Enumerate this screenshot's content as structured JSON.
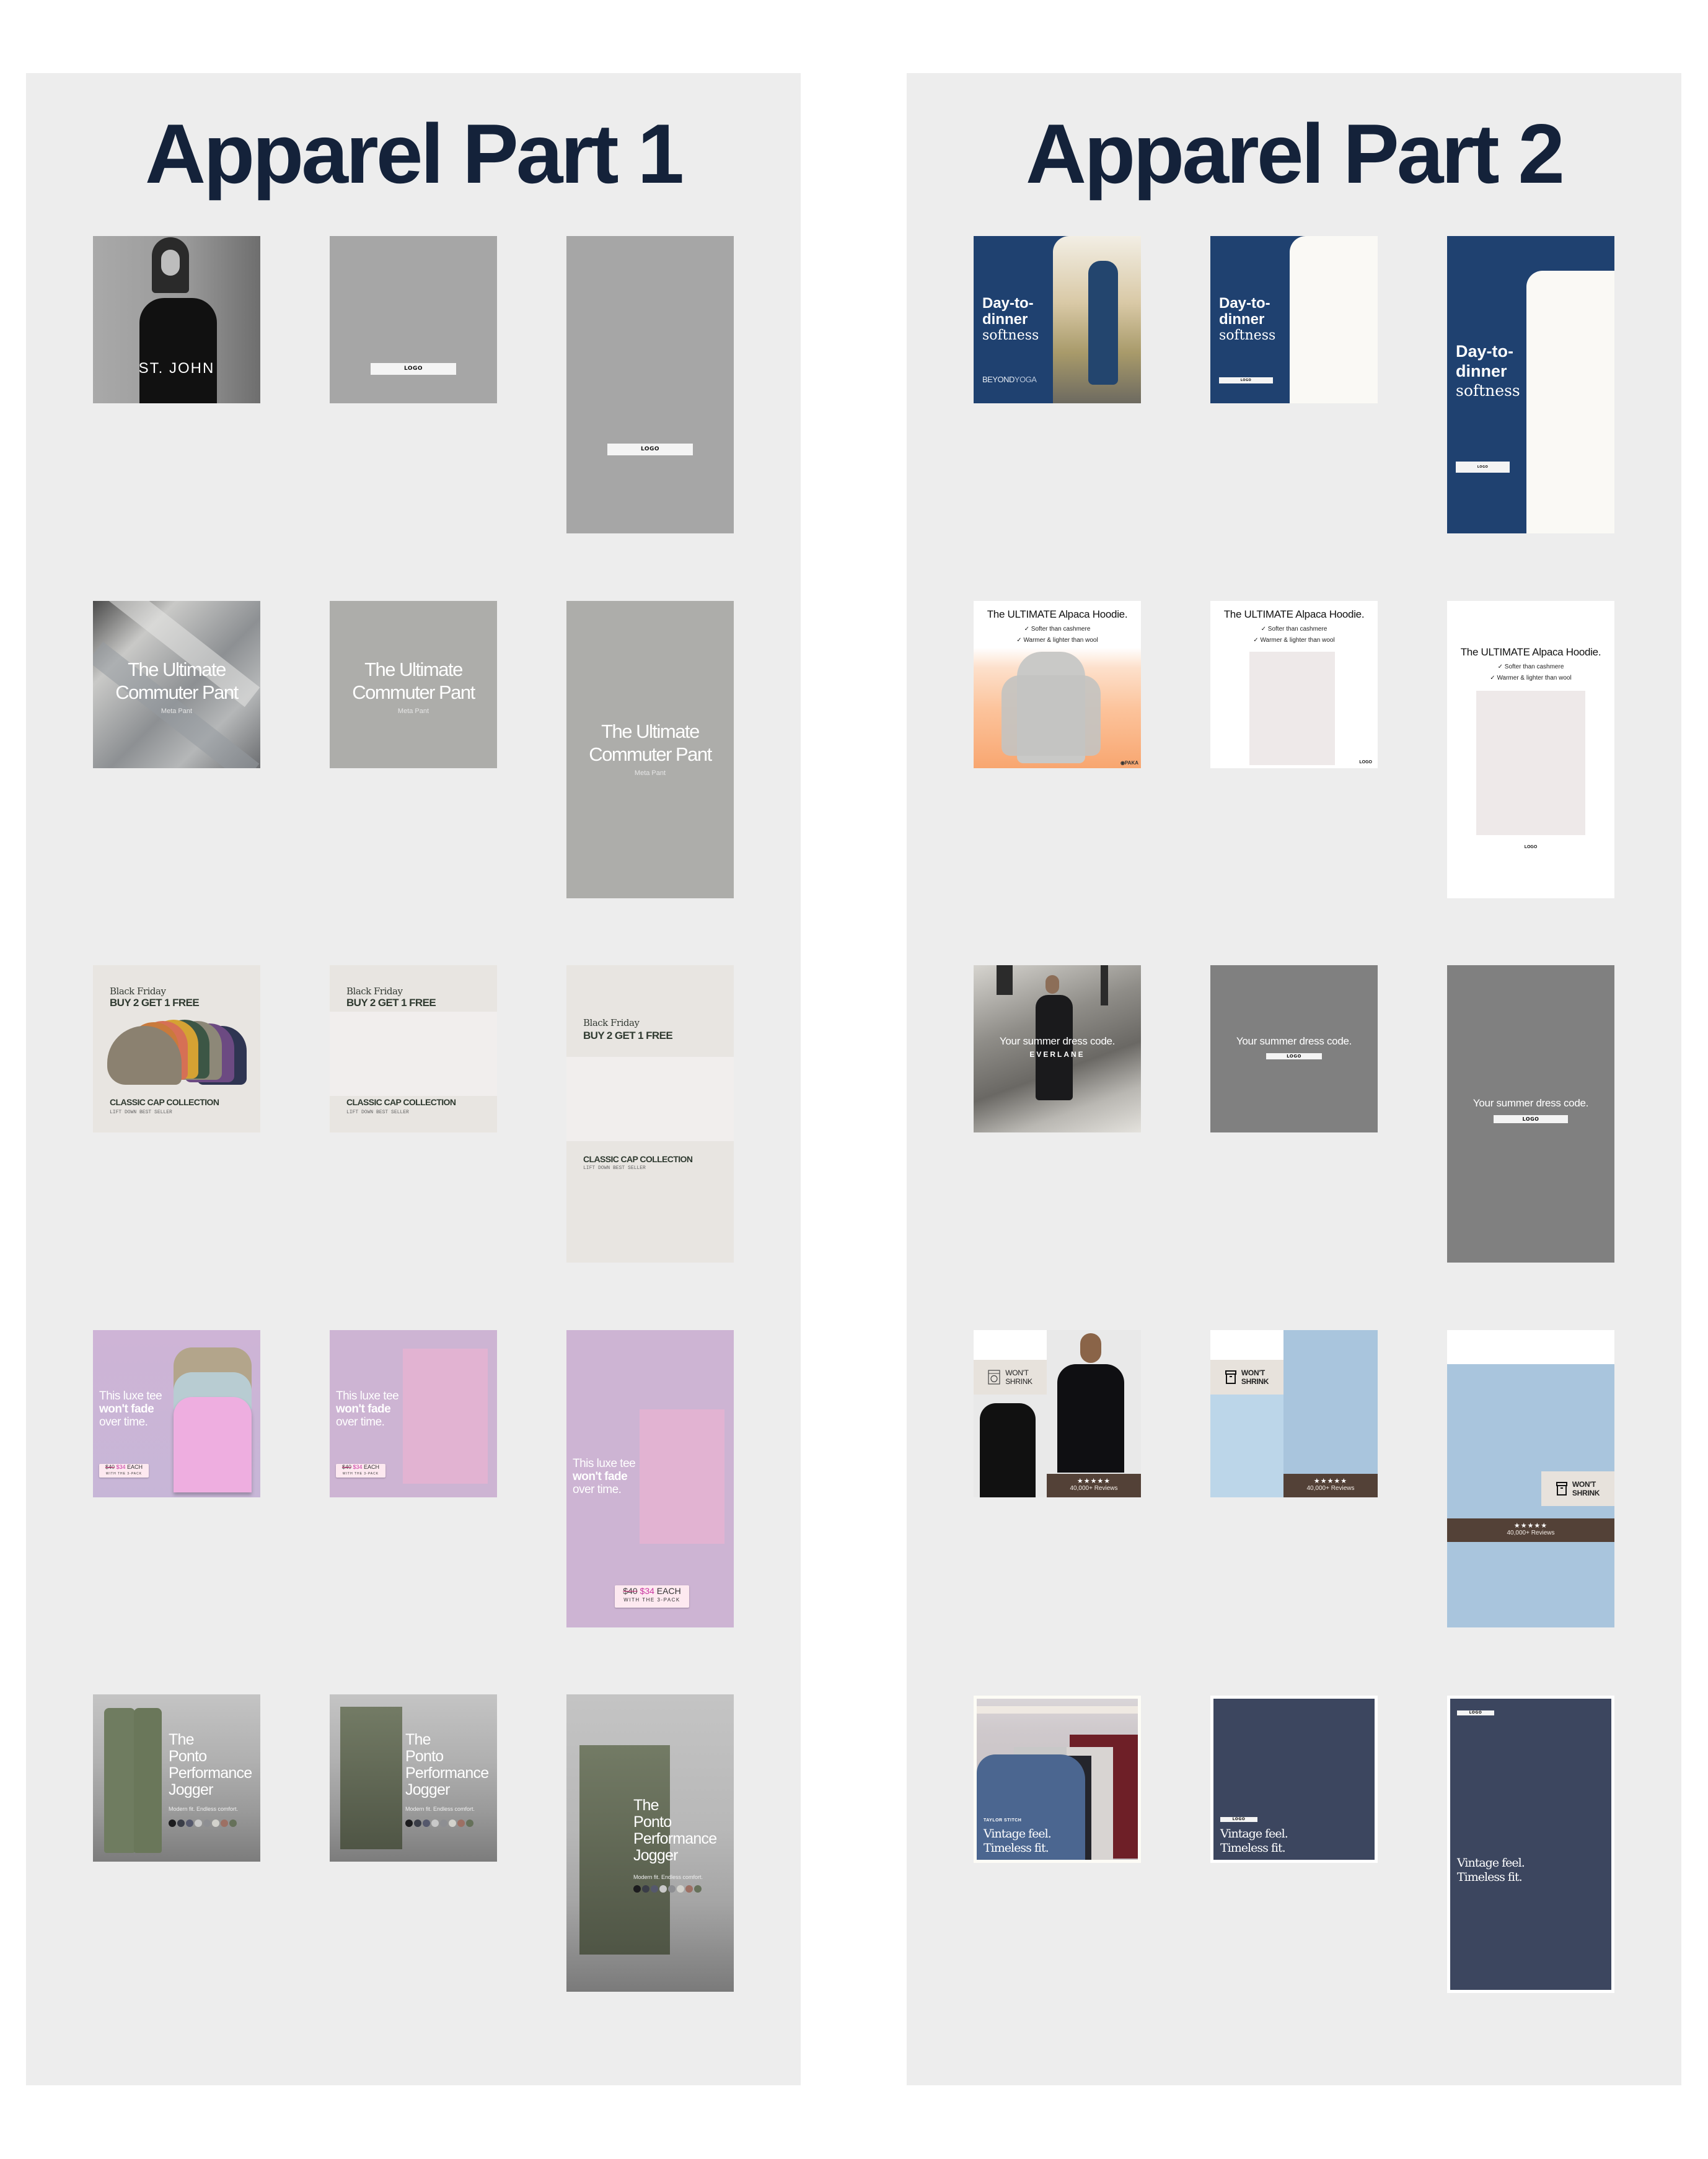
{
  "panels": [
    {
      "title": "Apparel Part 1"
    },
    {
      "title": "Apparel Part 2"
    }
  ],
  "common": {
    "logo_label": "LOGO"
  },
  "part1": {
    "stjohn": {
      "brand": "ST. JOHN"
    },
    "commuter": {
      "headline_line1": "The Ultimate",
      "headline_line2": "Commuter Pant",
      "sub": "Meta Pant",
      "bg": "#adadaa"
    },
    "caps": {
      "kicker": "Black Friday",
      "offer": "BUY 2 GET 1 FREE",
      "collection": "CLASSIC CAP COLLECTION",
      "tagline": "LIFT DOWN BEST SELLER"
    },
    "tee": {
      "line1": "This luxe tee",
      "line2": "won't fade",
      "line3": "over time.",
      "price_old": "$40",
      "price_new": "$34",
      "price_each": "EACH",
      "price_note": "WITH THE 3-PACK"
    },
    "jogger": {
      "line1": "The",
      "line2": "Ponto",
      "line3": "Performance",
      "line4": "Jogger",
      "sub": "Modern fit. Endless comfort.",
      "swatches": [
        "#1c1c1e",
        "#3a3d47",
        "#55586c",
        "#c9c9c9",
        "#8d8e92",
        "#d3d2cc",
        "#9d7064",
        "#66715a"
      ]
    }
  },
  "part2": {
    "beyond": {
      "line1": "Day-to-",
      "line2": "dinner",
      "line3": "softness",
      "brand_a": "BEYOND",
      "brand_b": "YOGA",
      "navy": "#1f4170"
    },
    "hoodie": {
      "title": "The ULTIMATE Alpaca Hoodie.",
      "bullet1": "Softer than cashmere",
      "bullet2": "Warmer & lighter than wool",
      "brand": "PAKA"
    },
    "dress": {
      "headline": "Your summer dress code.",
      "brand": "EVERLANE"
    },
    "shrink": {
      "line1": "WON'T",
      "line2": "SHRINK",
      "stars": "★★★★★",
      "reviews": "40,000+ Reviews"
    },
    "vintage": {
      "brand": "TAYLOR STITCH",
      "line1": "Vintage feel.",
      "line2": "Timeless fit."
    }
  }
}
